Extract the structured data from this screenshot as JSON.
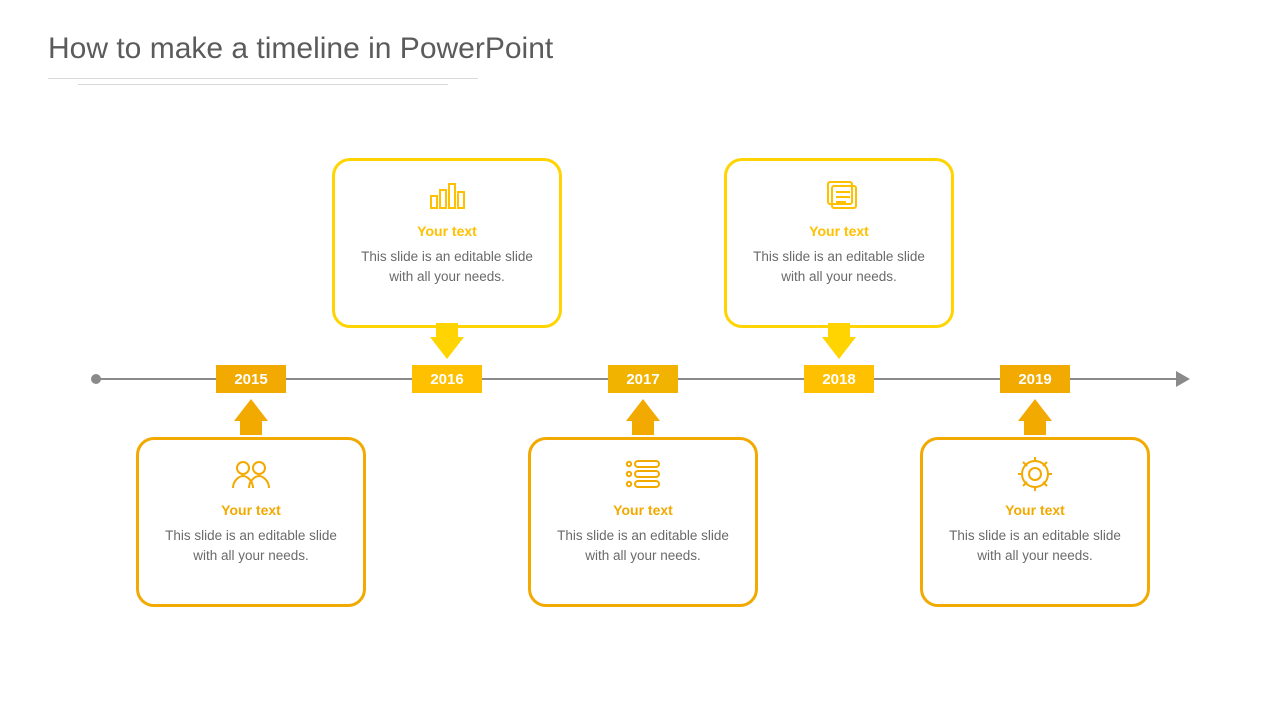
{
  "title": "How to make a timeline in PowerPoint",
  "colors": {
    "accent_top": "#ffd400",
    "accent_bottom": "#f2a900",
    "year_top": "#ffc000",
    "axis": "#8a8a8a"
  },
  "timeline": {
    "years": [
      "2015",
      "2016",
      "2017",
      "2018",
      "2019"
    ],
    "items": [
      {
        "year": "2015",
        "position": "bottom",
        "icon": "people-icon",
        "heading": "Your text",
        "body": "This slide is an editable slide with all your needs."
      },
      {
        "year": "2016",
        "position": "top",
        "icon": "bar-chart-icon",
        "heading": "Your text",
        "body": "This slide is an editable slide with all your needs."
      },
      {
        "year": "2017",
        "position": "bottom",
        "icon": "list-icon",
        "heading": "Your text",
        "body": "This slide is an editable slide with all your needs."
      },
      {
        "year": "2018",
        "position": "top",
        "icon": "document-icon",
        "heading": "Your text",
        "body": "This slide is an editable slide with all your needs."
      },
      {
        "year": "2019",
        "position": "bottom",
        "icon": "gear-icon",
        "heading": "Your text",
        "body": "This slide is an editable slide with all your needs."
      }
    ]
  }
}
